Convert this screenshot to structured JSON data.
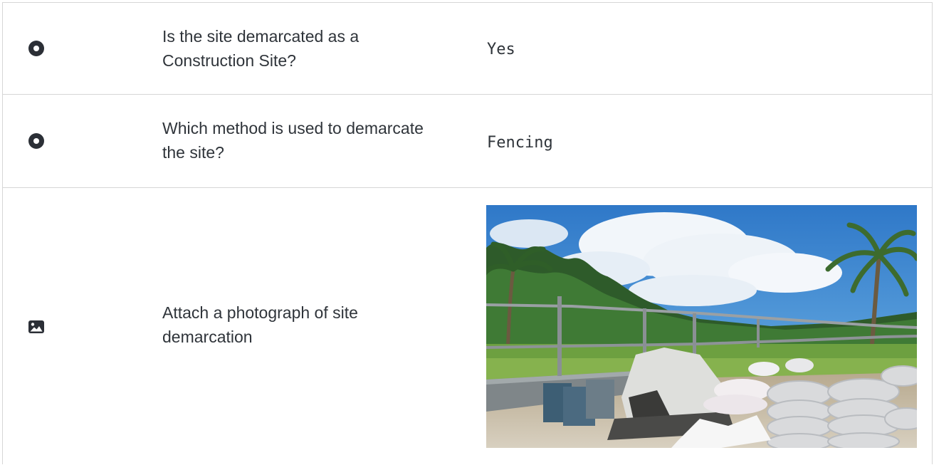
{
  "rows": [
    {
      "icon": "radio-selected-icon",
      "question": "Is the site demarcated as a Construction Site?",
      "answer": "Yes"
    },
    {
      "icon": "radio-selected-icon",
      "question": "Which method is used to demarcate the site?",
      "answer": "Fencing"
    },
    {
      "icon": "image-icon",
      "question": "Attach a photograph of site demarcation",
      "answer_type": "photo"
    }
  ]
}
